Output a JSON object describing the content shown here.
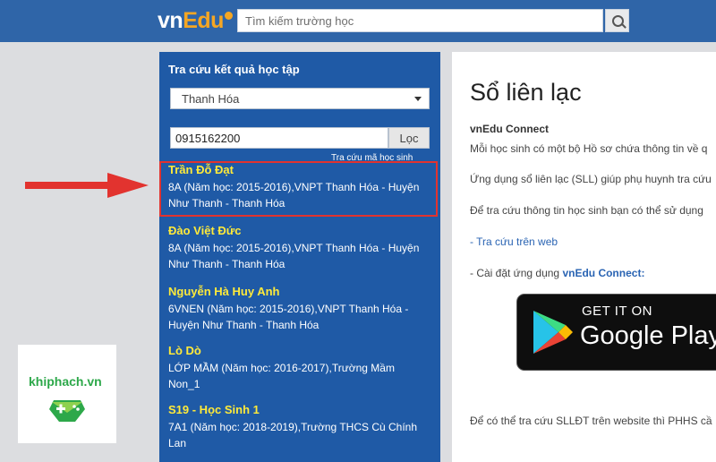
{
  "header": {
    "logo_main": "vn",
    "logo_accent": "Edu",
    "search_placeholder": "Tìm kiếm trường học"
  },
  "left_panel": {
    "title": "Tra cứu kết quả học tập",
    "province_selected": "Thanh Hóa",
    "phone_value": "0915162200",
    "filter_label": "Lọc",
    "lookup_link": "Tra cứu mã học sinh",
    "results": [
      {
        "name": "Trần Đỗ Đạt",
        "info_1": "8A (Năm học: 2015-2016),VNPT Thanh Hóa - Huyện",
        "info_2": "Như Thanh - Thanh Hóa"
      },
      {
        "name": "Đào Việt Đức",
        "info_1": "8A (Năm học: 2015-2016),VNPT Thanh Hóa - Huyện",
        "info_2": "Như Thanh - Thanh Hóa"
      },
      {
        "name": "Nguyễn Hà Huy Anh",
        "info_1": "6VNEN (Năm học: 2015-2016),VNPT Thanh Hóa -",
        "info_2": "Huyện Như Thanh - Thanh Hóa"
      },
      {
        "name": "Lò Dò",
        "info_1": "LỚP MẦM (Năm học: 2016-2017),Trường Mầm",
        "info_2": "Non_1"
      },
      {
        "name": "S19 - Học Sinh 1",
        "info_1": "7A1 (Năm học: 2018-2019),Trường THCS Cù Chính",
        "info_2": "Lan"
      }
    ]
  },
  "right_panel": {
    "title": "Sổ liên lạc",
    "subtitle": "vnEdu Connect",
    "line_1": "Mỗi học sinh có một bộ Hồ sơ chứa thông tin về q",
    "line_2": "Ứng dụng sổ liên lạc (SLL) giúp phụ huynh tra cứu",
    "line_3": "Để tra cứu thông tin học sinh bạn có thể sử dụng",
    "web_link": "- Tra cứu trên web",
    "install_prefix": "- Cài đặt ứng dụng ",
    "install_app": "vnEdu Connect:",
    "store_small": "GET IT ON",
    "store_big": "Google Play",
    "footer_line": "Để có thể tra cứu SLLĐT trên website thì PHHS cầ"
  },
  "watermark": {
    "site": "khiphach.vn"
  },
  "colors": {
    "header_bg": "#2f65a8",
    "panel_bg": "#1f5aa6",
    "result_name": "#ffea3a",
    "highlight": "#e2332f",
    "arrow": "#e2332f"
  }
}
